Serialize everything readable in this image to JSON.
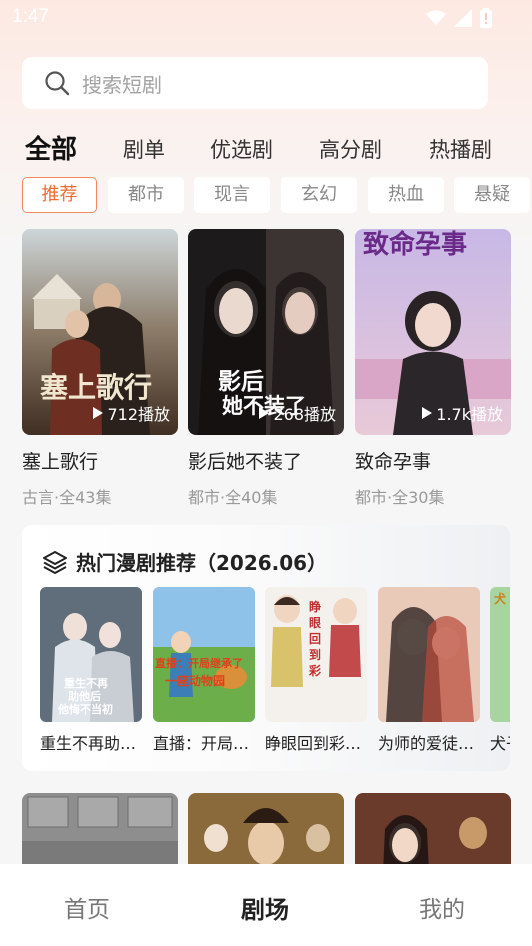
{
  "status_bar": {
    "time": "1:47"
  },
  "search": {
    "placeholder": "搜索短剧"
  },
  "main_tabs": [
    {
      "label": "全部",
      "active": true
    },
    {
      "label": "剧单",
      "active": false
    },
    {
      "label": "优选剧",
      "active": false
    },
    {
      "label": "高分剧",
      "active": false
    },
    {
      "label": "热播剧",
      "active": false
    }
  ],
  "genres": [
    {
      "label": "推荐",
      "active": true
    },
    {
      "label": "都市",
      "active": false
    },
    {
      "label": "现言",
      "active": false
    },
    {
      "label": "玄幻",
      "active": false
    },
    {
      "label": "热血",
      "active": false
    },
    {
      "label": "悬疑",
      "active": false
    }
  ],
  "dramas": [
    {
      "title": "塞上歌行",
      "meta": "古言·全43集",
      "plays": "712播放",
      "cover_text": "塞上歌行"
    },
    {
      "title": "影后她不装了",
      "meta": "都市·全40集",
      "plays": "268播放",
      "cover_text": "影后她不装了"
    },
    {
      "title": "致命孕事",
      "meta": "都市·全30集",
      "plays": "1.7k播放",
      "cover_text": "致命孕事"
    }
  ],
  "hot_section": {
    "title": "热门漫剧推荐（2026.06）",
    "items": [
      {
        "name": "重生不再助…",
        "cover_text": "重生不再助他登后他悔不当初"
      },
      {
        "name": "直播：开局…",
        "cover_text": "直播：开局继承了一座动物园"
      },
      {
        "name": "睁眼回到彩…",
        "cover_text": "睁眼回到彩礼前"
      },
      {
        "name": "为师的爱徒…",
        "cover_text": ""
      },
      {
        "name": "犬子",
        "cover_text": ""
      }
    ]
  },
  "bottom_nav": [
    {
      "label": "首页",
      "active": false
    },
    {
      "label": "剧场",
      "active": true
    },
    {
      "label": "我的",
      "active": false
    }
  ],
  "colors": {
    "accent": "#f06a2f",
    "background_top": "#fde9e2"
  }
}
